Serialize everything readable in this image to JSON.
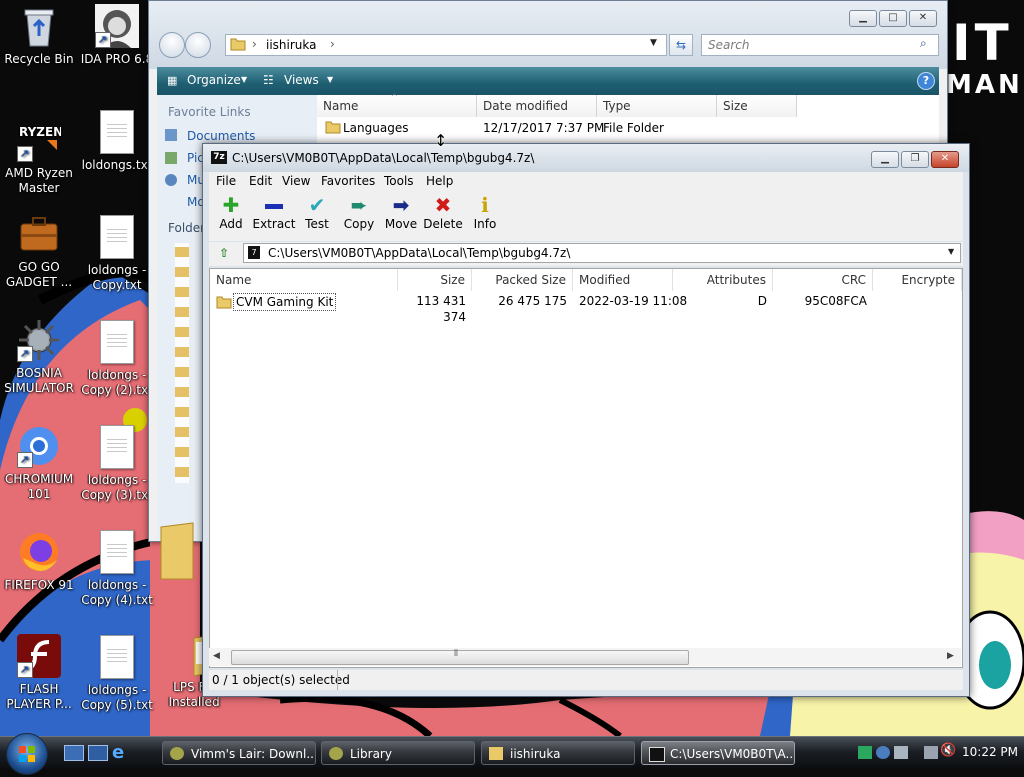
{
  "desktop": {
    "icons": [
      {
        "label": "Recycle Bin"
      },
      {
        "label": "IDA PRO 6.8"
      },
      {
        "label": "AMD Ryzen Master"
      },
      {
        "label": "loldongs.txt"
      },
      {
        "label": "GO GO GADGET ..."
      },
      {
        "label": "loldongs - Copy.txt"
      },
      {
        "label": "BOSNIA SIMULATOR"
      },
      {
        "label": "loldongs - Copy (2).txt"
      },
      {
        "label": "CHROMIUM 101"
      },
      {
        "label": "loldongs - Copy (3).txt"
      },
      {
        "label": "FIREFOX 91"
      },
      {
        "label": "loldongs - Copy (4).txt"
      },
      {
        "label": "FLASH PLAYER P..."
      },
      {
        "label": "loldongs - Copy (5).txt"
      },
      {
        "label": "LPS F... Installed"
      }
    ]
  },
  "explorer": {
    "breadcrumb": "iishiruka",
    "search_placeholder": "Search",
    "toolbar": {
      "organize": "Organize",
      "views": "Views"
    },
    "favorite_links_title": "Favorite Links",
    "favorite_links": [
      "Documents",
      "Pic",
      "Mu",
      "Mo"
    ],
    "folders_label": "Folder",
    "columns": [
      "Name",
      "Date modified",
      "Type",
      "Size"
    ],
    "rows": [
      {
        "name": "Languages",
        "date": "12/17/2017 7:37 PM",
        "type": "File Folder",
        "size": ""
      }
    ]
  },
  "sevenzip": {
    "title": "C:\\Users\\VM0B0T\\AppData\\Local\\Temp\\bgubg4.7z\\",
    "menu": [
      "File",
      "Edit",
      "View",
      "Favorites",
      "Tools",
      "Help"
    ],
    "toolbar": [
      {
        "label": "Add",
        "icon": "plus-icon",
        "color": "#2aa52a"
      },
      {
        "label": "Extract",
        "icon": "minus-icon",
        "color": "#1a2fb5"
      },
      {
        "label": "Test",
        "icon": "checkmark-icon",
        "color": "#2aa8b8"
      },
      {
        "label": "Copy",
        "icon": "double-arrow-icon",
        "color": "#1e8a70"
      },
      {
        "label": "Move",
        "icon": "arrow-icon",
        "color": "#1a2a8a"
      },
      {
        "label": "Delete",
        "icon": "x-icon",
        "color": "#d11a1a"
      },
      {
        "label": "Info",
        "icon": "info-icon",
        "color": "#c9a400"
      }
    ],
    "path": "C:\\Users\\VM0B0T\\AppData\\Local\\Temp\\bgubg4.7z\\",
    "columns": [
      "Name",
      "Size",
      "Packed Size",
      "Modified",
      "Attributes",
      "CRC",
      "Encrypte"
    ],
    "rows": [
      {
        "name": "CVM Gaming Kit",
        "size": "113 431 374",
        "packed": "26 475 175",
        "modified": "2022-03-19 11:08",
        "attributes": "D",
        "crc": "95C08FCA"
      }
    ],
    "status": "0 / 1 object(s) selected"
  },
  "taskbar": {
    "tasks": [
      {
        "label": "Vimm's Lair: Downl..."
      },
      {
        "label": "Library"
      },
      {
        "label": "iishiruka"
      },
      {
        "label": "C:\\Users\\VM0B0T\\A..."
      }
    ],
    "clock": "10:22 PM"
  },
  "wallpaper": {
    "text_fragments": [
      "IT",
      "MAN"
    ]
  }
}
